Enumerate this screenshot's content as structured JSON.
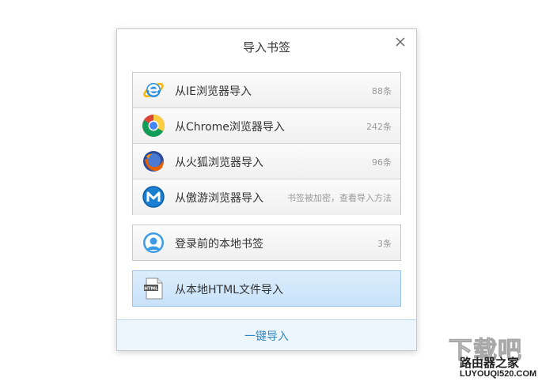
{
  "dialog": {
    "title": "导入书签",
    "close_icon": "close-icon"
  },
  "browser_sources": [
    {
      "icon": "ie-icon",
      "label": "从IE浏览器导入",
      "count": "88条"
    },
    {
      "icon": "chrome-icon",
      "label": "从Chrome浏览器导入",
      "count": "242条"
    },
    {
      "icon": "firefox-icon",
      "label": "从火狐浏览器导入",
      "count": "96条"
    },
    {
      "icon": "maxthon-icon",
      "label": "从傲游浏览器导入",
      "count": "书签被加密，查看导入方法"
    }
  ],
  "local_bookmarks": {
    "icon": "avatar-icon",
    "label": "登录前的本地书签",
    "count": "3条"
  },
  "html_import": {
    "icon": "html-file-icon",
    "icon_text": "HTML",
    "label": "从本地HTML文件导入"
  },
  "footer": {
    "label": "一键导入"
  },
  "watermark": {
    "logo_text": "下载吧",
    "cn_text": "路由器之家",
    "en_text": "LUYOUQI520.COM"
  },
  "colors": {
    "accent": "#2f88c9",
    "selected_row": "#cfe6fb",
    "text": "#333333",
    "muted": "#999999"
  }
}
